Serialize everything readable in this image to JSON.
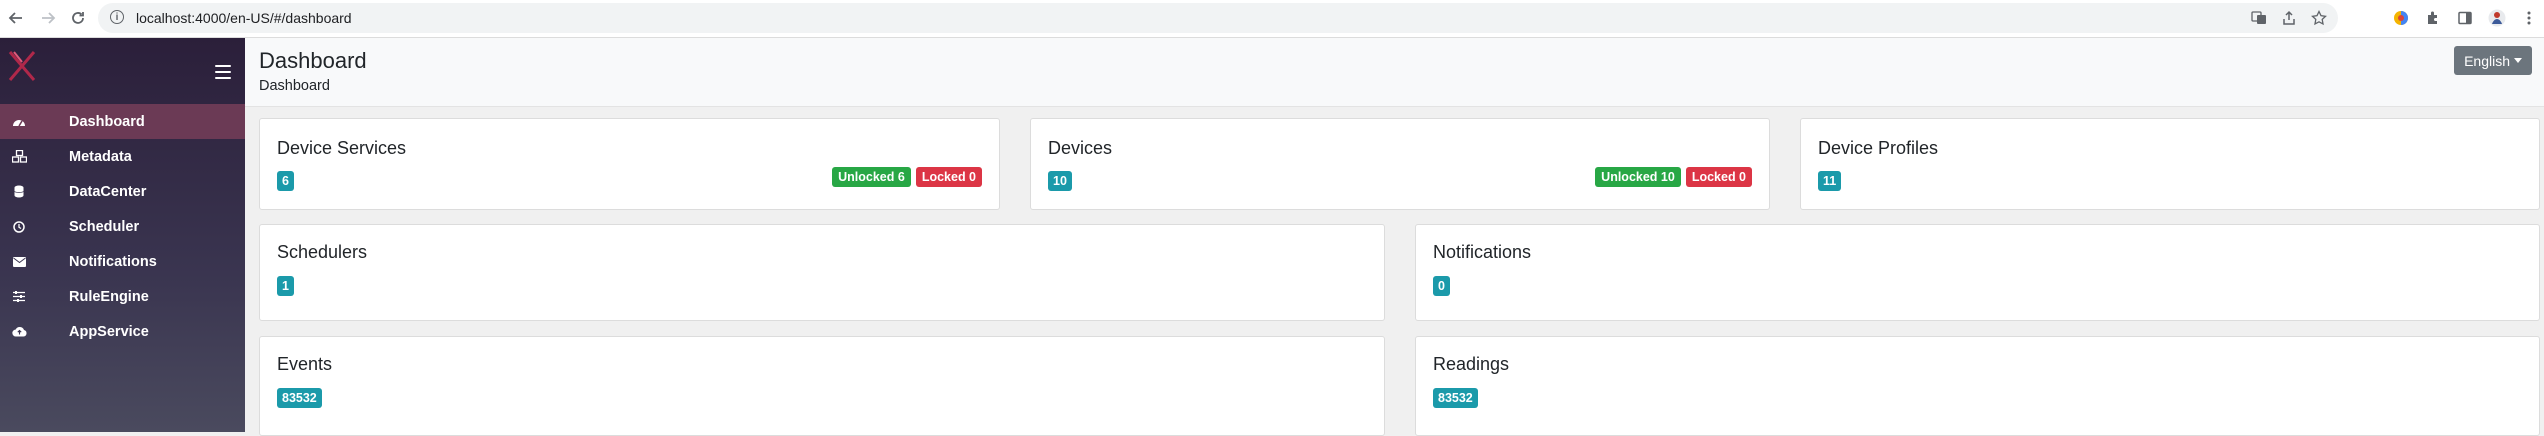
{
  "browser": {
    "url": "localhost:4000/en-US/#/dashboard",
    "nav_icons": [
      "back-icon",
      "forward-icon",
      "reload-icon"
    ],
    "omnibox_icons": [
      "info-icon",
      "translate-icon",
      "share-icon",
      "star-icon"
    ],
    "extension_icons": [
      "extension-colorful-icon",
      "puzzle-icon",
      "sidepanel-icon",
      "profile-icon",
      "more-icon"
    ]
  },
  "sidebar": {
    "logo_icon": "edgex-logo-icon",
    "items": [
      {
        "label": "Dashboard",
        "icon": "dashboard-gauge-icon",
        "active": true
      },
      {
        "label": "Metadata",
        "icon": "cubes-icon",
        "active": false
      },
      {
        "label": "DataCenter",
        "icon": "database-icon",
        "active": false
      },
      {
        "label": "Scheduler",
        "icon": "clock-icon",
        "active": false
      },
      {
        "label": "Notifications",
        "icon": "envelope-icon",
        "active": false
      },
      {
        "label": "RuleEngine",
        "icon": "sliders-icon",
        "active": false
      },
      {
        "label": "AppService",
        "icon": "cloud-upload-icon",
        "active": false
      }
    ]
  },
  "header": {
    "title": "Dashboard",
    "breadcrumb": "Dashboard",
    "language": "English"
  },
  "cards": {
    "device_services": {
      "title": "Device Services",
      "count": "6",
      "unlocked": "Unlocked 6",
      "locked": "Locked 0"
    },
    "devices": {
      "title": "Devices",
      "count": "10",
      "unlocked": "Unlocked 10",
      "locked": "Locked 0"
    },
    "device_profiles": {
      "title": "Device Profiles",
      "count": "11"
    },
    "schedulers": {
      "title": "Schedulers",
      "count": "1"
    },
    "notifications": {
      "title": "Notifications",
      "count": "0"
    },
    "events": {
      "title": "Events",
      "count": "83532"
    },
    "readings": {
      "title": "Readings",
      "count": "83532"
    }
  },
  "colors": {
    "sidebar_active": "#6b3a55",
    "count_badge": "#1b9aaa",
    "unlocked_badge": "#28a745",
    "locked_badge": "#dc3545"
  }
}
